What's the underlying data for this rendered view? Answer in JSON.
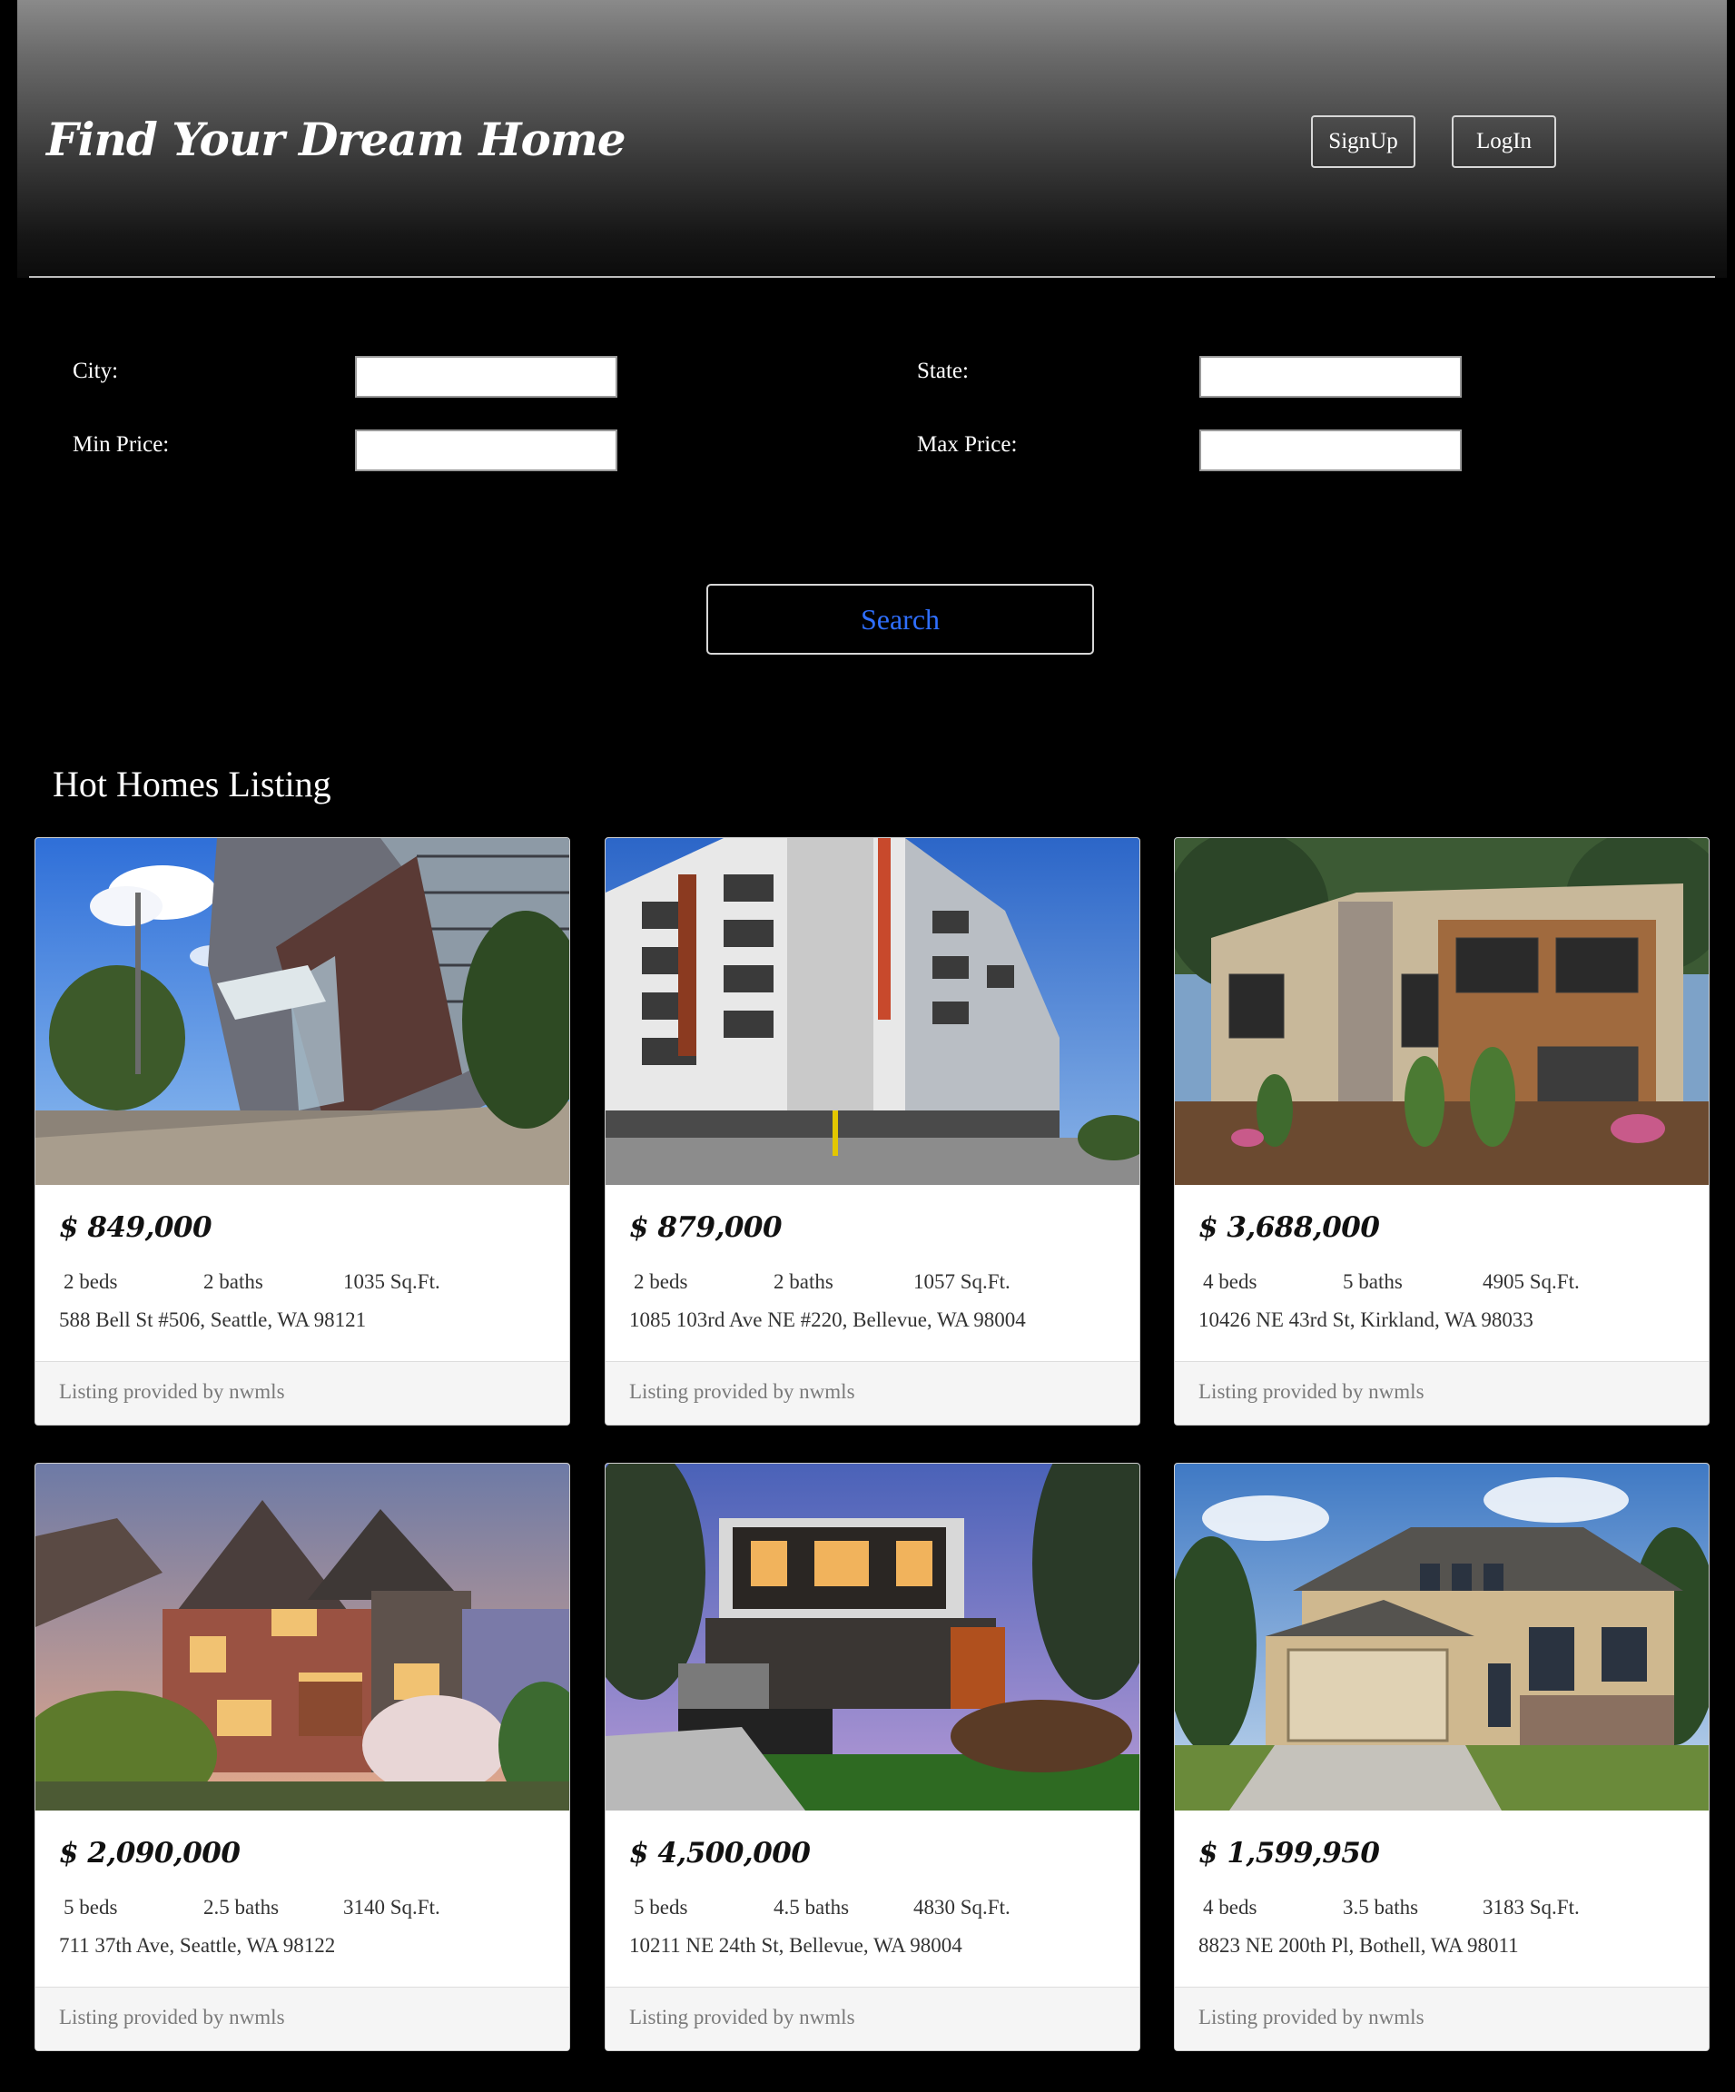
{
  "header": {
    "brand": "Find Your Dream Home",
    "signup_label": "SignUp",
    "login_label": "LogIn"
  },
  "search_form": {
    "city_label": "City:",
    "city_value": "",
    "state_label": "State:",
    "state_value": "",
    "min_price_label": "Min Price:",
    "min_price_value": "",
    "max_price_label": "Max Price:",
    "max_price_value": "",
    "search_label": "Search"
  },
  "listing": {
    "title": "Hot Homes Listing",
    "cards": [
      {
        "price": "$ 849,000",
        "beds": "2 beds",
        "baths": "2 baths",
        "sqft": "1035 Sq.Ft.",
        "address": "588 Bell St #506, Seattle, WA 98121",
        "footer": "Listing provided by nwmls",
        "image": "apartment-tower-photo"
      },
      {
        "price": "$ 879,000",
        "beds": "2 beds",
        "baths": "2 baths",
        "sqft": "1057 Sq.Ft.",
        "address": "1085 103rd Ave NE #220, Bellevue, WA 98004",
        "footer": "Listing provided by nwmls",
        "image": "condo-building-photo"
      },
      {
        "price": "$ 3,688,000",
        "beds": "4 beds",
        "baths": "5 baths",
        "sqft": "4905 Sq.Ft.",
        "address": "10426 NE 43rd St, Kirkland, WA 98033",
        "footer": "Listing provided by nwmls",
        "image": "modern-house-photo"
      },
      {
        "price": "$ 2,090,000",
        "beds": "5 beds",
        "baths": "2.5 baths",
        "sqft": "3140 Sq.Ft.",
        "address": "711 37th Ave, Seattle, WA 98122",
        "footer": "Listing provided by nwmls",
        "image": "tudor-house-photo"
      },
      {
        "price": "$ 4,500,000",
        "beds": "5 beds",
        "baths": "4.5 baths",
        "sqft": "4830 Sq.Ft.",
        "address": "10211 NE 24th St, Bellevue, WA 98004",
        "footer": "Listing provided by nwmls",
        "image": "contemporary-house-photo"
      },
      {
        "price": "$ 1,599,950",
        "beds": "4 beds",
        "baths": "3.5 baths",
        "sqft": "3183 Sq.Ft.",
        "address": "8823 NE 200th Pl, Bothell, WA 98011",
        "footer": "Listing provided by nwmls",
        "image": "suburban-house-photo"
      }
    ]
  },
  "colors": {
    "page_background": "#000000",
    "search_text": "#2f6fff",
    "card_footer_background": "#f5f5f5"
  }
}
